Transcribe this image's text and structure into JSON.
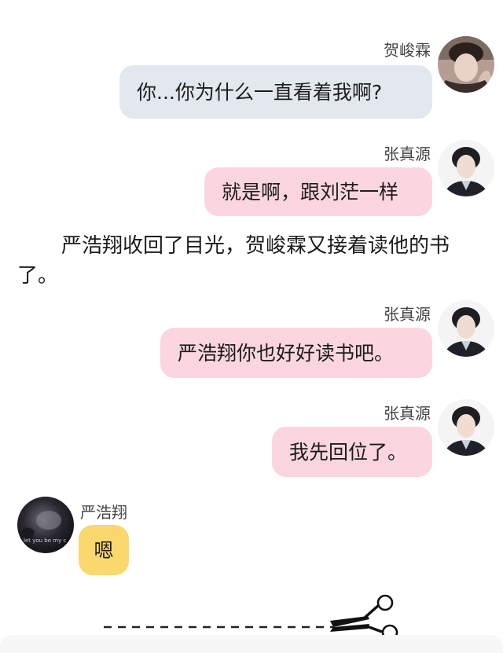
{
  "messages": [
    {
      "sender": "贺峻霖",
      "text": "你...你为什么一直看着我啊?"
    },
    {
      "sender": "张真源",
      "text": "就是啊，跟刘茫一样"
    },
    {
      "sender": "张真源",
      "text": "严浩翔你也好好读书吧。"
    },
    {
      "sender": "张真源",
      "text": "我先回位了。"
    },
    {
      "sender": "严浩翔",
      "text": "嗯"
    }
  ],
  "narration": "严浩翔收回了目光，贺峻霖又接着读他的书了。",
  "avatar_caption": "let you be my c",
  "colors": {
    "gray_bubble": "#e3e8ef",
    "pink_bubble": "#fbd6de",
    "yellow_bubble": "#fbd86d"
  }
}
